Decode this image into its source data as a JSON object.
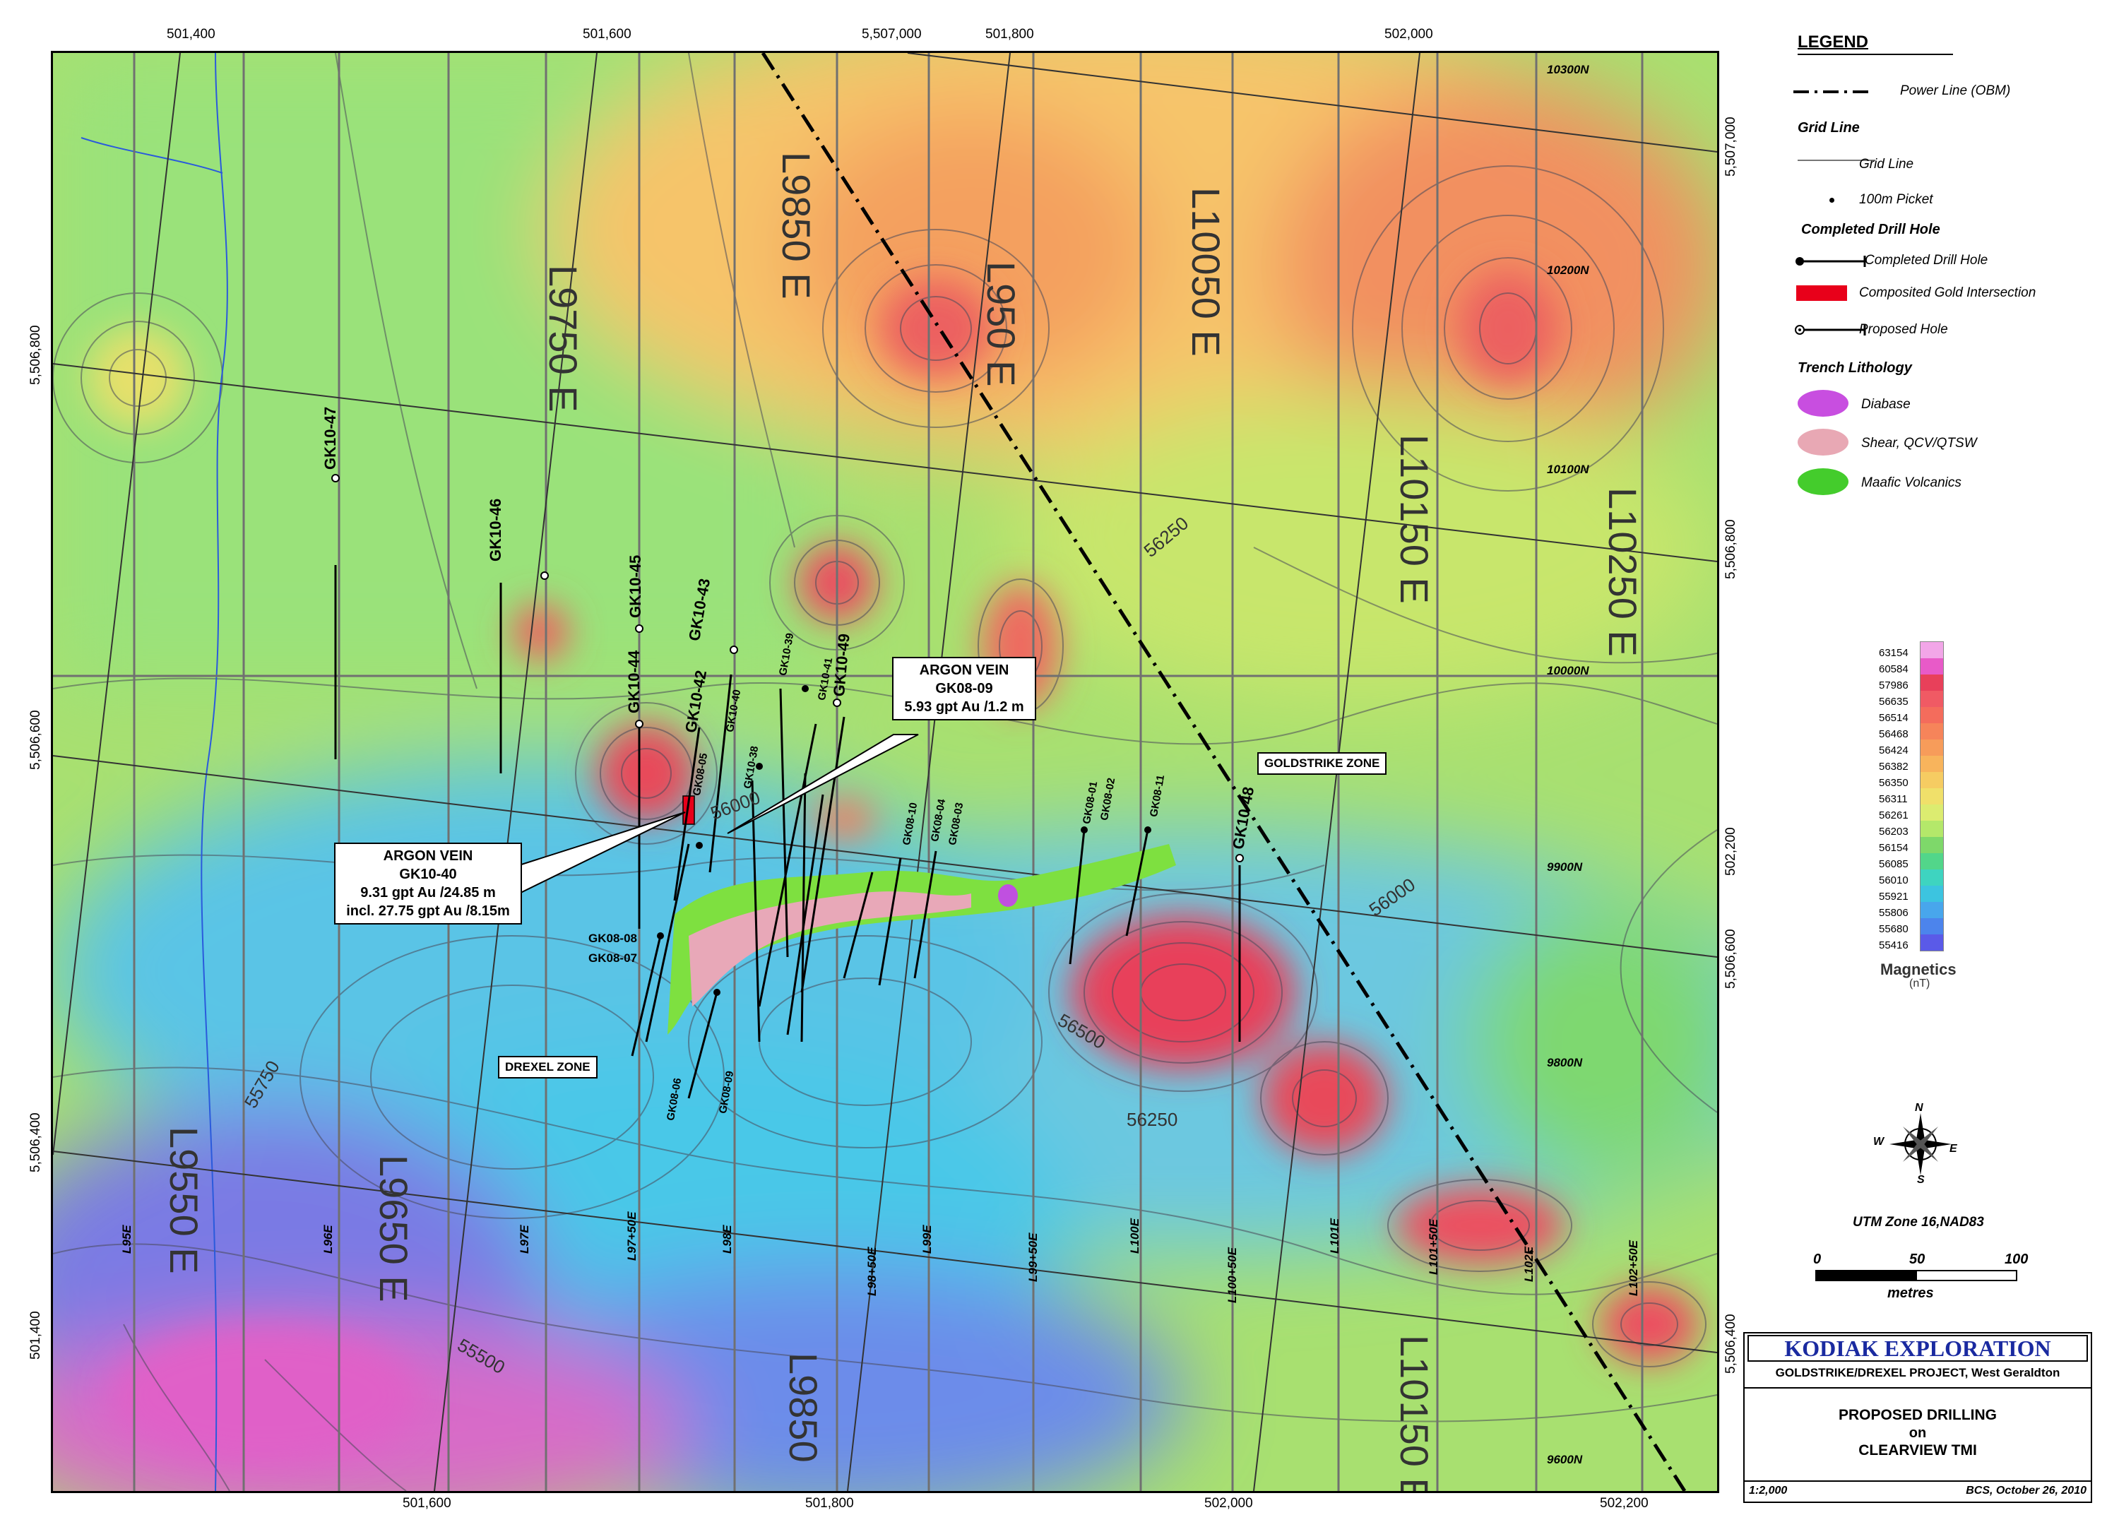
{
  "top_coords": [
    "501,400",
    "501,600",
    "5,507,000",
    "501,800",
    "502,000"
  ],
  "bottom_coords": [
    "501,600",
    "501,800",
    "502,000",
    "502,200"
  ],
  "left_coords": [
    "5,506,800",
    "5,506,600",
    "5,506,400",
    "501,400"
  ],
  "right_coords": [
    "5,507,000",
    "5,506,800",
    "502,200",
    "5,506,600",
    "5,506,400"
  ],
  "grid_lines_ns": [
    "L9750 E",
    "L9850 E",
    "L950 E",
    "L10050 E",
    "L10150 E",
    "L10250 E",
    "L9650 E",
    "L9550 E",
    "L9850",
    "L10150 E"
  ],
  "lower_lines": [
    "L95E",
    "L96E",
    "L97E",
    "L97+50E",
    "L98E",
    "L98+50E",
    "L99E",
    "L99+50E",
    "L100E",
    "L100+50E",
    "L101E",
    "L101+50E",
    "L102E",
    "L102+50E"
  ],
  "northings": [
    "10300N",
    "10200N",
    "10100N",
    "10000N",
    "9900N",
    "9800N",
    "9600N"
  ],
  "contour_labels": [
    "56250",
    "56000",
    "56500",
    "56250",
    "55750",
    "56000",
    "55500"
  ],
  "holes": [
    "GK10-47",
    "GK10-46",
    "GK10-45",
    "GK10-43",
    "GK10-44",
    "GK10-42",
    "GK10-40",
    "GK10-38",
    "GK10-39",
    "GK10-41",
    "GK10-49",
    "GK08-05",
    "GK08-10",
    "GK08-04",
    "GK08-03",
    "GK08-01",
    "GK08-02",
    "GK08-11",
    "GK10-48",
    "GK08-08",
    "GK08-07",
    "GK08-06",
    "GK08-09"
  ],
  "zones": {
    "drexel": "DREXEL ZONE",
    "goldstrike": "GOLDSTRIKE ZONE"
  },
  "callout1": {
    "l1": "ARGON VEIN",
    "l2": "GK08-09",
    "l3": "5.93 gpt Au /1.2 m"
  },
  "callout2": {
    "l1": "ARGON VEIN",
    "l2": "GK10-40",
    "l3": "9.31 gpt Au /24.85 m",
    "l4": "incl. 27.75 gpt Au /8.15m"
  },
  "legend": {
    "title": "LEGEND",
    "power_line": "Power Line (OBM)",
    "grid_line_head": "Grid Line",
    "grid_line": "Grid Line",
    "picket": "100m Picket",
    "completed_head": "Completed Drill Hole",
    "completed": "Completed Drill Hole",
    "gold": "Composited Gold Intersection",
    "proposed": "Proposed Hole",
    "trench_head": "Trench Lithology",
    "diabase": "Diabase",
    "shear": "Shear, QCV/QTSW",
    "mafic": "Maafic Volcanics"
  },
  "colorbar": {
    "values": [
      "63154",
      "60584",
      "57986",
      "56635",
      "56514",
      "56468",
      "56424",
      "56382",
      "56350",
      "56311",
      "56261",
      "56203",
      "56154",
      "56085",
      "56010",
      "55921",
      "55806",
      "55680",
      "55416"
    ],
    "colors": [
      "#f2a6e8",
      "#e85ac8",
      "#e8405a",
      "#f05a64",
      "#f46c5c",
      "#f6845a",
      "#f79c5a",
      "#f8b45c",
      "#f6cc62",
      "#f0e06a",
      "#dcec70",
      "#b4e86a",
      "#7ed86a",
      "#52d68a",
      "#3ed4c0",
      "#3cc4e0",
      "#48a6ec",
      "#4c84ec",
      "#5a5ae8"
    ],
    "label": "Magnetics",
    "unit": "(nT)"
  },
  "compass": {
    "n": "N",
    "s": "S",
    "e": "E",
    "w": "W"
  },
  "projection": "UTM Zone 16,NAD83",
  "scale": {
    "v0": "0",
    "v1": "50",
    "v2": "100",
    "unit": "metres"
  },
  "title": {
    "company": "KODIAK EXPLORATION",
    "project": "GOLDSTRIKE/DREXEL PROJECT, West Geraldton",
    "l1": "PROPOSED DRILLING",
    "l2": "on",
    "l3": "CLEARVIEW TMI",
    "scale": "1:2,000",
    "credit": "BCS, October 26, 2010"
  }
}
